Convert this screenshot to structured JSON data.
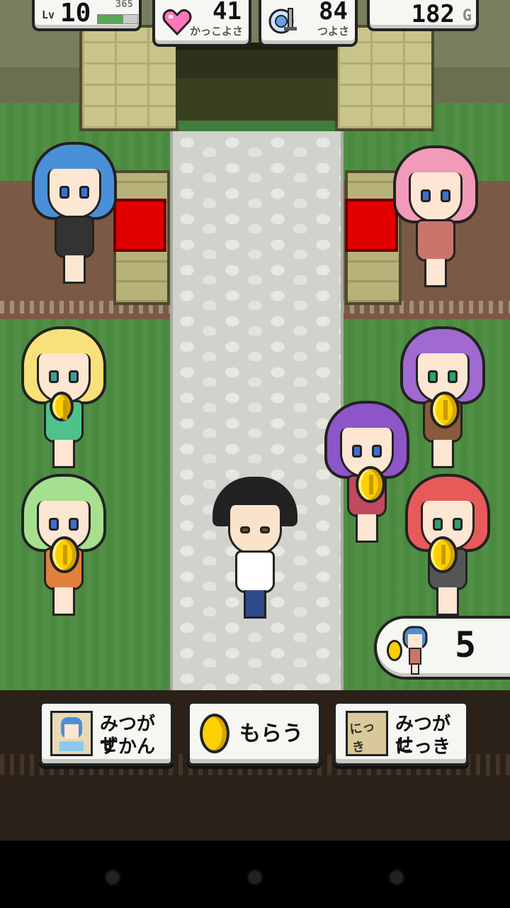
{
  "hud": {
    "level_label": "Lv",
    "level": "10",
    "exp": "365",
    "exp_fraction": 0.65,
    "charm_value": "41",
    "charm_label": "かっこよさ",
    "power_value": "84",
    "power_label": "つよさ",
    "gold_value": "182",
    "gold_unit": "G"
  },
  "found_counter": {
    "value": "5",
    "icon": "girl-coin-icon"
  },
  "buttons": {
    "zukan": {
      "label_line1": "みつがせ",
      "label_line2": "ずかん",
      "icon": "portrait-card-icon"
    },
    "get": {
      "label": "もらう",
      "icon": "coin-icon"
    },
    "diary": {
      "label_line1": "みつがせ",
      "label_line2": "にっき",
      "icon": "diary-note-icon",
      "icon_text": "にっき"
    }
  },
  "colors": {
    "coin": "#ffd000",
    "heart": "#ff77bb",
    "throne_red": "#e00000",
    "grass": "#4a8a3e",
    "panel": "#f6f6f3"
  },
  "characters": [
    {
      "name": "blue-hair-girl",
      "hair": "#4a90d8"
    },
    {
      "name": "pink-hair-girl",
      "hair": "#f29ab8"
    },
    {
      "name": "blonde-girl",
      "hair": "#f8e07a",
      "has_coin": true
    },
    {
      "name": "purple-hair-girl-back",
      "hair": "#a06ad0",
      "has_coin": true
    },
    {
      "name": "purple-hair-girl-front",
      "hair": "#8e55c8",
      "has_coin": true
    },
    {
      "name": "green-hair-girl",
      "hair": "#a6e08e",
      "has_coin": true
    },
    {
      "name": "red-hair-girl",
      "hair": "#e85a5a",
      "has_coin": true
    },
    {
      "name": "player-boy",
      "hair": "#222222"
    }
  ]
}
